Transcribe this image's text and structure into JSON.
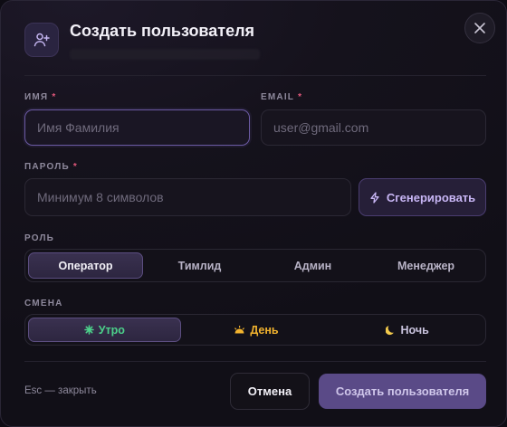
{
  "dialog": {
    "title": "Создать пользователя",
    "close_icon": "close-icon",
    "header_icon": "user-plus-icon"
  },
  "form": {
    "name": {
      "label": "ИМЯ",
      "required": "*",
      "value": "",
      "placeholder": "Имя Фамилия"
    },
    "email": {
      "label": "EMAIL",
      "required": "*",
      "value": "",
      "placeholder": "user@gmail.com"
    },
    "password": {
      "label": "ПАРОЛЬ",
      "required": "*",
      "value": "",
      "placeholder": "Минимум 8 символов"
    },
    "generate_button": {
      "label": "Сгенерировать",
      "icon": "lightning-icon"
    },
    "role": {
      "label": "РОЛЬ",
      "options": [
        "Оператор",
        "Тимлид",
        "Админ",
        "Менеджер"
      ],
      "selected": "Оператор"
    },
    "shift": {
      "label": "СМЕНА",
      "options": [
        {
          "label": "Утро",
          "icon": "sparkle-icon",
          "color": "#4cd08a"
        },
        {
          "label": "День",
          "icon": "sun-icon",
          "color": "#f2b32e"
        },
        {
          "label": "Ночь",
          "icon": "moon-icon",
          "color": "#c9c3dd"
        }
      ],
      "selected": "Утро"
    }
  },
  "footer": {
    "hint": "Esc — закрыть",
    "cancel_label": "Отмена",
    "submit_label": "Создать пользователя"
  },
  "colors": {
    "accent": "#6b5aa3",
    "required": "#e0577a",
    "background": "#15121c"
  }
}
